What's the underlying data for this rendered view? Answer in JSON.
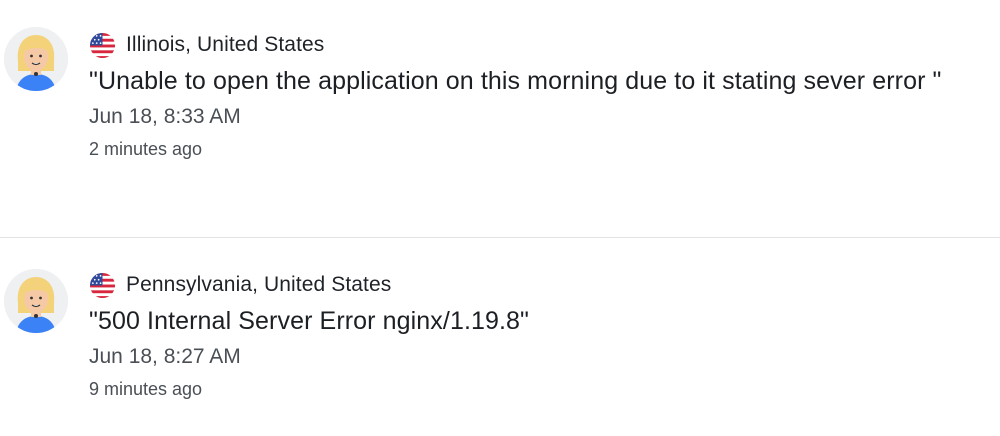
{
  "reports": [
    {
      "location": "Illinois, United States",
      "flag_icon": "us-flag-icon",
      "avatar_icon": "user-avatar-icon",
      "message": "\"Unable to open the application on this morning due to it stating sever error \"",
      "date": "Jun 18, 8:33 AM",
      "relative_time": "2 minutes ago"
    },
    {
      "location": "Pennsylvania, United States",
      "flag_icon": "us-flag-icon",
      "avatar_icon": "user-avatar-icon",
      "message": "\"500 Internal Server Error nginx/1.19.8\"",
      "date": "Jun 18, 8:27 AM",
      "relative_time": "9 minutes ago"
    }
  ],
  "colors": {
    "divider": "#e3e3e3",
    "avatar_bg": "#eef0f1",
    "hair": "#f3d27a",
    "skin": "#f6c9a6",
    "shirt": "#3b82f6",
    "flag_red": "#d7263d",
    "flag_blue": "#2f4a9a"
  }
}
